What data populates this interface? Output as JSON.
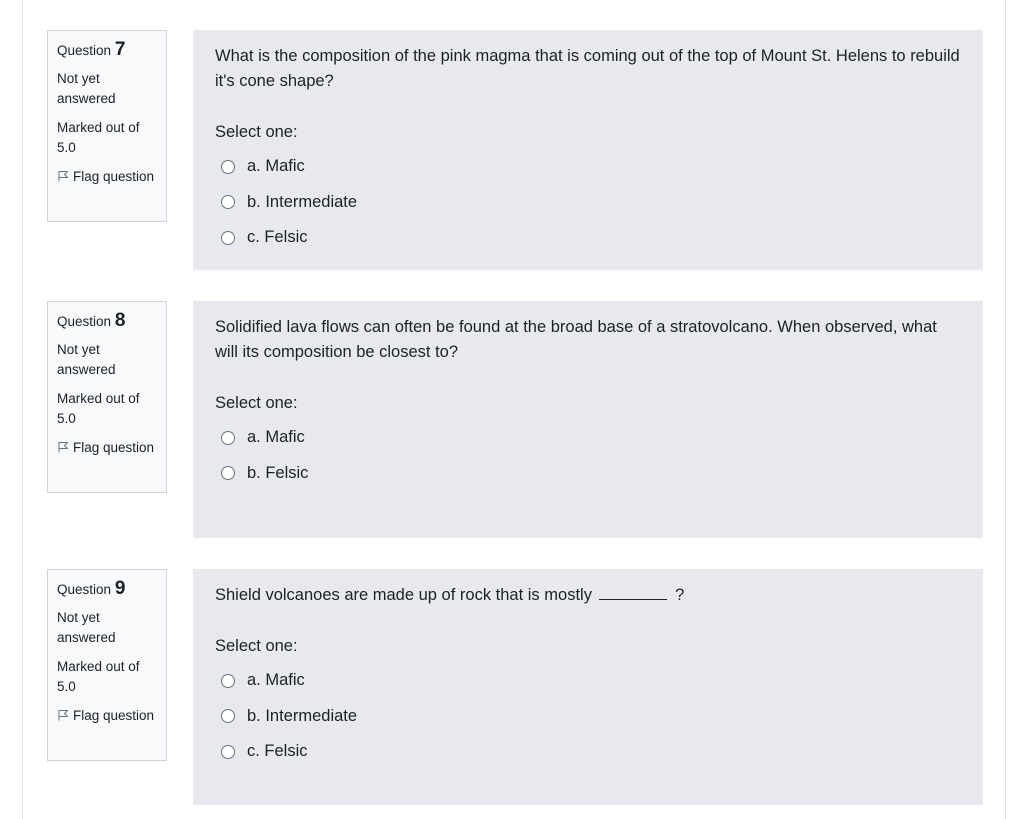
{
  "questions": [
    {
      "label": "Question",
      "number": "7",
      "state": "Not yet answered",
      "grade": "Marked out of 5.0",
      "flag": "Flag question",
      "text": "What is the composition of the pink magma that is coming out of the top of Mount St. Helens to rebuild it's cone shape?",
      "prompt": "Select one:",
      "options": [
        "a. Mafic",
        "b. Intermediate",
        "c. Felsic"
      ]
    },
    {
      "label": "Question",
      "number": "8",
      "state": "Not yet answered",
      "grade": "Marked out of 5.0",
      "flag": "Flag question",
      "text": "Solidified lava flows can often be found at the broad base of a stratovolcano.  When observed, what will its composition be closest to?",
      "prompt": "Select one:",
      "options": [
        "a. Mafic",
        "b. Felsic"
      ]
    },
    {
      "label": "Question",
      "number": "9",
      "state": "Not yet answered",
      "grade": "Marked out of 5.0",
      "flag": "Flag question",
      "text_before_blank": "Shield volcanoes are made up of rock that is mostly",
      "text_after_blank": "?",
      "prompt": "Select one:",
      "options": [
        "a. Mafic",
        "b. Intermediate",
        "c. Felsic"
      ]
    }
  ]
}
